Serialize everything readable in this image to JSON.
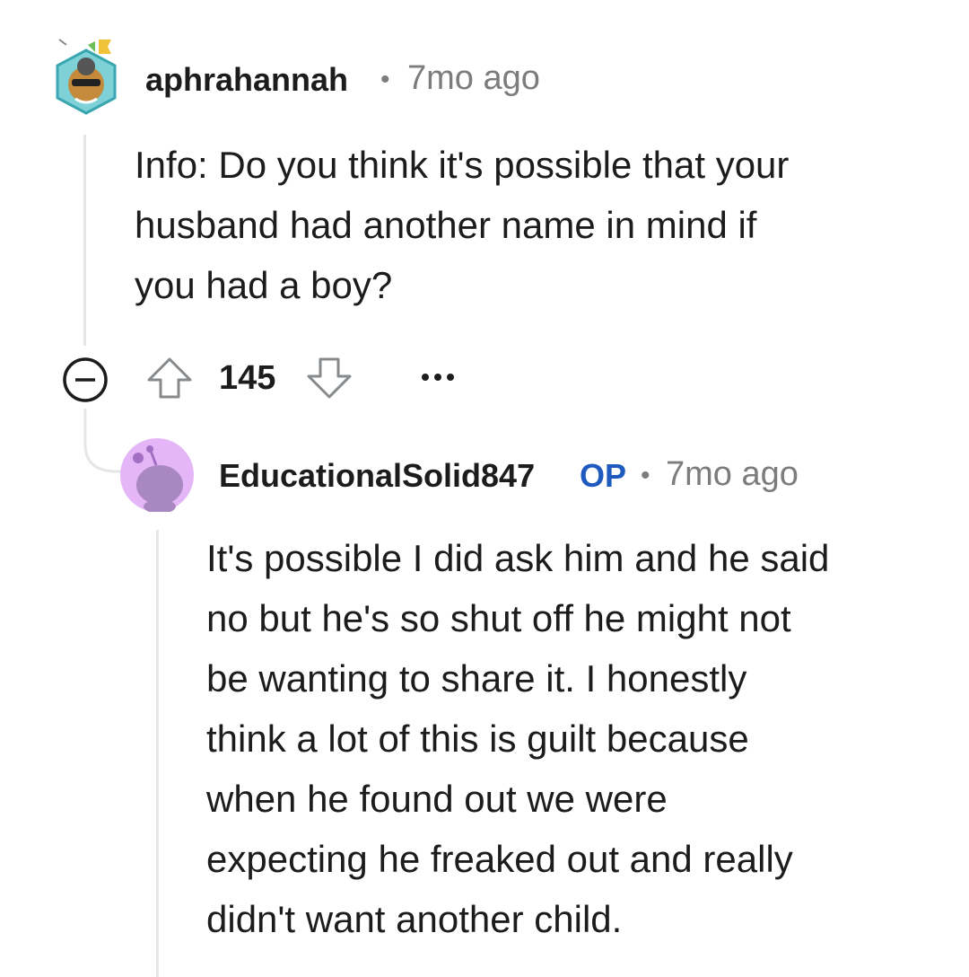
{
  "parent_comment": {
    "username": "aphrahannah",
    "timestamp": "7mo ago",
    "body_lines": [
      "Info: Do you think it's possible that your",
      "husband had another name in mind if",
      "you had a boy?"
    ],
    "vote_count": "145",
    "avatar_icon": "snoo-avatar-hexagon-icon"
  },
  "reply_comment": {
    "username": "EducationalSolid847",
    "op_badge": "OP",
    "timestamp": "7mo ago",
    "body_lines": [
      "It's possible I did ask him and he said",
      "no but he's so shut off he might not",
      "be wanting to share it. I honestly",
      "think a lot of this is guilt because",
      "when he found out we were",
      "expecting he freaked out and really",
      "didn't want another child."
    ],
    "avatar_icon": "default-snoo-avatar-icon"
  },
  "colors": {
    "op_badge": "#1f5bbf",
    "meta_text": "#7c7c7c",
    "thread_line": "#e6e6e6",
    "reply_avatar_bg": "#e5b6f7"
  }
}
